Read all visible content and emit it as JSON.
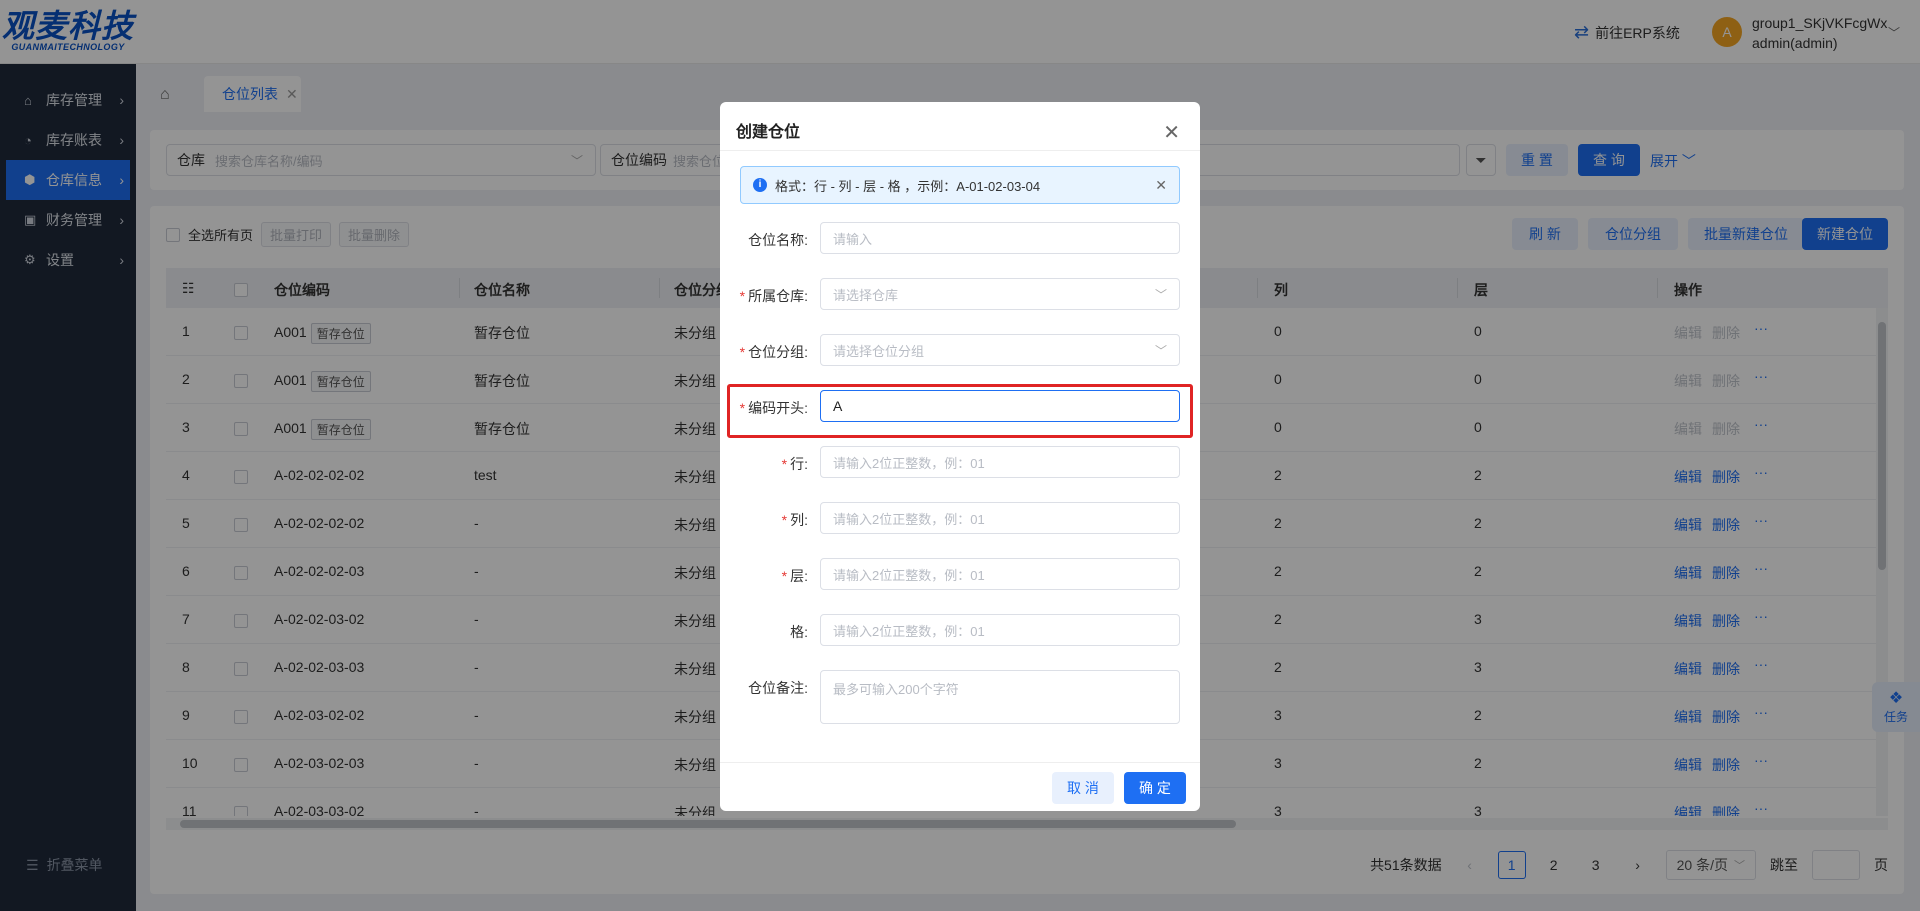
{
  "header": {
    "logo_cn": "观麦科技",
    "logo_en": "GUANMAITECHNOLOGY",
    "erp_link": "前往ERP系统",
    "avatar_letter": "A",
    "user_group": "group1_SKjVKFcgWx",
    "user_name": "admin(admin)"
  },
  "sidebar": {
    "items": [
      {
        "label": "库存管理",
        "icon": "warehouse-icon",
        "active": false
      },
      {
        "label": "库存账表",
        "icon": "pie-chart-icon",
        "active": false
      },
      {
        "label": "仓库信息",
        "icon": "cube-icon",
        "active": true
      },
      {
        "label": "财务管理",
        "icon": "finance-icon",
        "active": false
      },
      {
        "label": "设置",
        "icon": "gear-icon",
        "active": false
      }
    ],
    "collapse_label": "折叠菜单"
  },
  "tabs": [
    {
      "label": "仓位列表"
    }
  ],
  "filter": {
    "warehouse_label": "仓库",
    "warehouse_placeholder": "搜索仓库名称/编码",
    "code_label": "仓位编码",
    "code_placeholder": "搜索仓位",
    "reset": "重 置",
    "query": "查 询",
    "expand": "展开"
  },
  "toolbar": {
    "select_all": "全选所有页",
    "batch_print": "批量打印",
    "batch_delete": "批量删除",
    "refresh": "刷 新",
    "group": "仓位分组",
    "batch_create": "批量新建仓位",
    "create": "新建仓位"
  },
  "table": {
    "columns": [
      "仓位编码",
      "仓位名称",
      "仓位分组",
      "列",
      "层",
      "操作"
    ],
    "rows": [
      {
        "no": "1",
        "code": "A001",
        "badge": "暂存仓位",
        "name": "暂存仓位",
        "group": "未分组",
        "col": "0",
        "layer": "0",
        "editable": false
      },
      {
        "no": "2",
        "code": "A001",
        "badge": "暂存仓位",
        "name": "暂存仓位",
        "group": "未分组",
        "col": "0",
        "layer": "0",
        "editable": false
      },
      {
        "no": "3",
        "code": "A001",
        "badge": "暂存仓位",
        "name": "暂存仓位",
        "group": "未分组",
        "col": "0",
        "layer": "0",
        "editable": false
      },
      {
        "no": "4",
        "code": "A-02-02-02-02",
        "badge": "",
        "name": "test",
        "group": "未分组",
        "col": "2",
        "layer": "2",
        "editable": true
      },
      {
        "no": "5",
        "code": "A-02-02-02-02",
        "badge": "",
        "name": "-",
        "group": "未分组",
        "col": "2",
        "layer": "2",
        "editable": true
      },
      {
        "no": "6",
        "code": "A-02-02-02-03",
        "badge": "",
        "name": "-",
        "group": "未分组",
        "col": "2",
        "layer": "2",
        "editable": true
      },
      {
        "no": "7",
        "code": "A-02-02-03-02",
        "badge": "",
        "name": "-",
        "group": "未分组",
        "col": "2",
        "layer": "3",
        "editable": true
      },
      {
        "no": "8",
        "code": "A-02-02-03-03",
        "badge": "",
        "name": "-",
        "group": "未分组",
        "col": "2",
        "layer": "3",
        "editable": true
      },
      {
        "no": "9",
        "code": "A-02-03-02-02",
        "badge": "",
        "name": "-",
        "group": "未分组",
        "col": "3",
        "layer": "2",
        "editable": true
      },
      {
        "no": "10",
        "code": "A-02-03-02-03",
        "badge": "",
        "name": "-",
        "group": "未分组",
        "col": "3",
        "layer": "2",
        "editable": true
      },
      {
        "no": "11",
        "code": "A-02-03-03-02",
        "badge": "",
        "name": "-",
        "group": "未分组",
        "col": "3",
        "layer": "3",
        "editable": true
      }
    ],
    "edit": "编辑",
    "delete": "删除",
    "more": "···"
  },
  "pager": {
    "total": "共51条数据",
    "pages": [
      "1",
      "2",
      "3"
    ],
    "current": "1",
    "page_size": "20 条/页",
    "jump_label": "跳至",
    "page_unit": "页"
  },
  "task_label": "任务",
  "modal": {
    "title": "创建仓位",
    "alert": "格式：行 - 列 - 层 - 格 ，示例：A-01-02-03-04",
    "fields": {
      "name": {
        "label": "仓位名称:",
        "placeholder": "请输入"
      },
      "warehouse": {
        "label": "所属仓库:",
        "placeholder": "请选择仓库"
      },
      "group": {
        "label": "仓位分组:",
        "placeholder": "请选择仓位分组"
      },
      "prefix": {
        "label": "编码开头:",
        "value": "A"
      },
      "row": {
        "label": "行:",
        "placeholder": "请输入2位正整数，例：01"
      },
      "col": {
        "label": "列:",
        "placeholder": "请输入2位正整数，例：01"
      },
      "layer": {
        "label": "层:",
        "placeholder": "请输入2位正整数，例：01"
      },
      "cell": {
        "label": "格:",
        "placeholder": "请输入2位正整数，例：01"
      },
      "remark": {
        "label": "仓位备注:",
        "placeholder": "最多可输入200个字符"
      }
    },
    "cancel": "取 消",
    "confirm": "确 定"
  },
  "colors": {
    "accent": "#1e6ff3",
    "sidebar": "#1f2a3b",
    "highlight": "#e02424"
  }
}
